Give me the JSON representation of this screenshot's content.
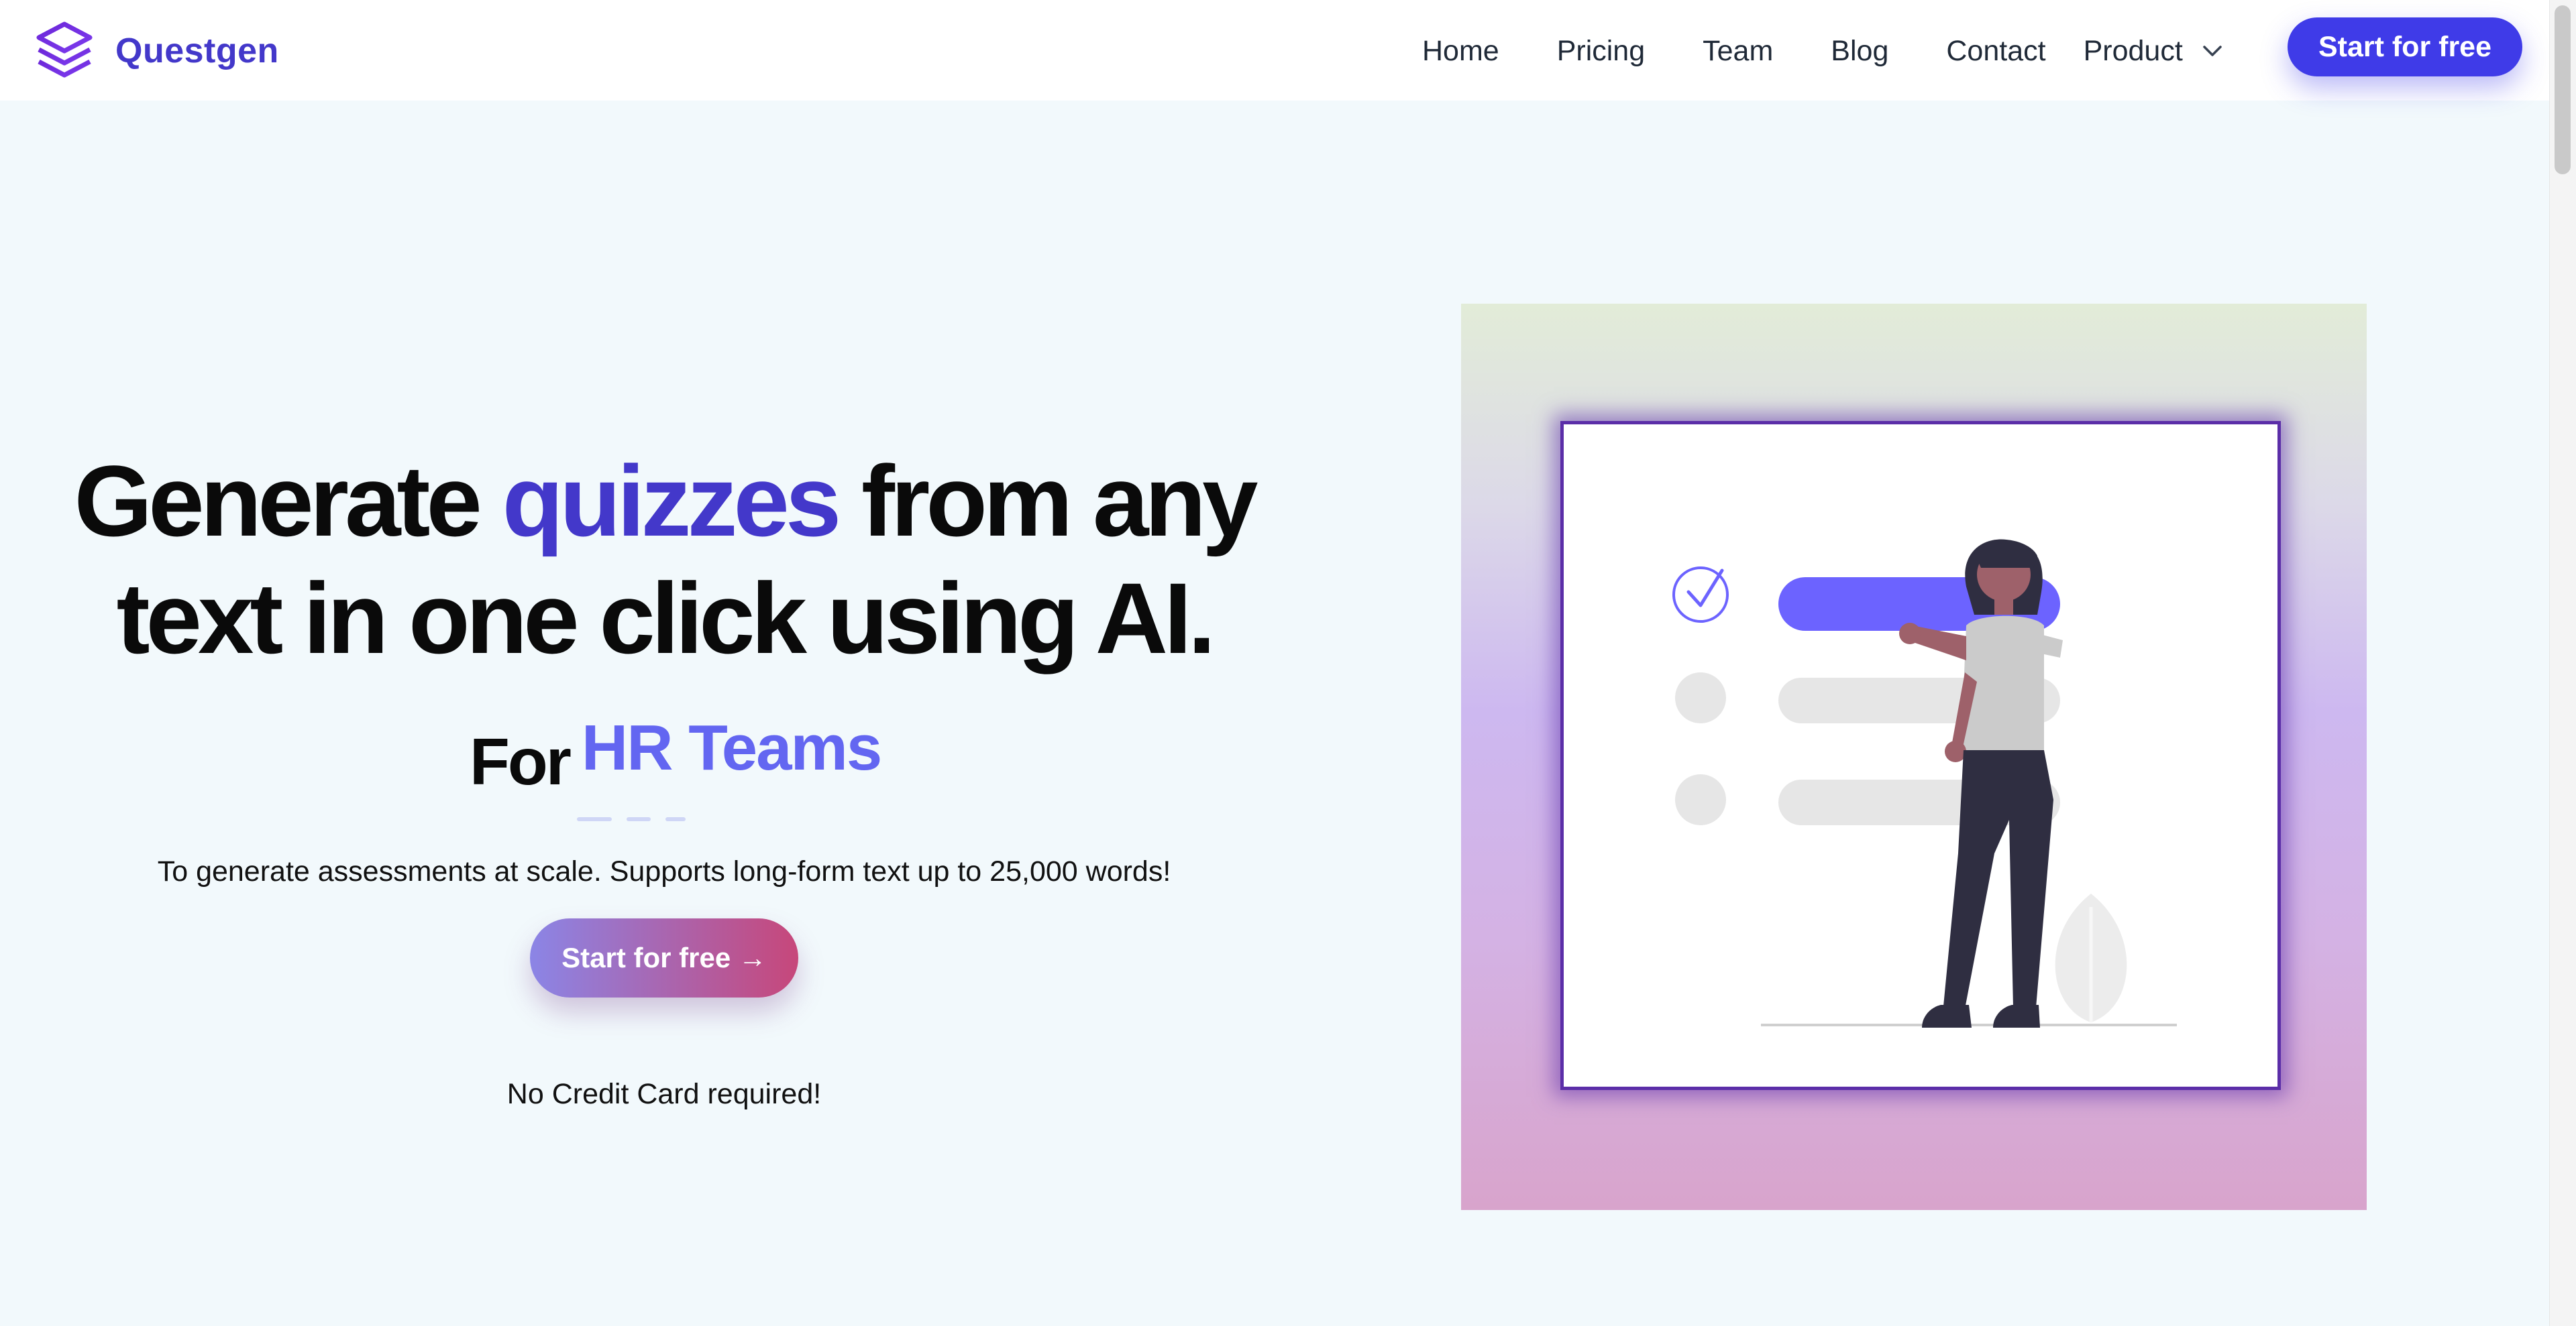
{
  "brand": {
    "name": "Questgen",
    "icon": "layers-icon",
    "color": "#4338ca"
  },
  "nav": {
    "links": [
      "Home",
      "Pricing",
      "Team",
      "Blog",
      "Contact"
    ],
    "product_label": "Product",
    "cta_label": "Start for free"
  },
  "hero": {
    "headline_prefix": "Generate ",
    "headline_accent": "quizzes",
    "headline_rest_1": " from any",
    "headline_line_2": "text in one click using AI.",
    "for_word": "For",
    "audience": "HR Teams",
    "subtitle": "To generate assessments at scale. Supports long-form text up to 25,000 words!",
    "cta_label": "Start for free →",
    "note": "No Credit Card required!"
  },
  "illustration": {
    "name": "checklist-woman-illustration"
  },
  "colors": {
    "accent": "#4338ca",
    "button": "#3f3be8",
    "background": "#f2f9fc"
  }
}
